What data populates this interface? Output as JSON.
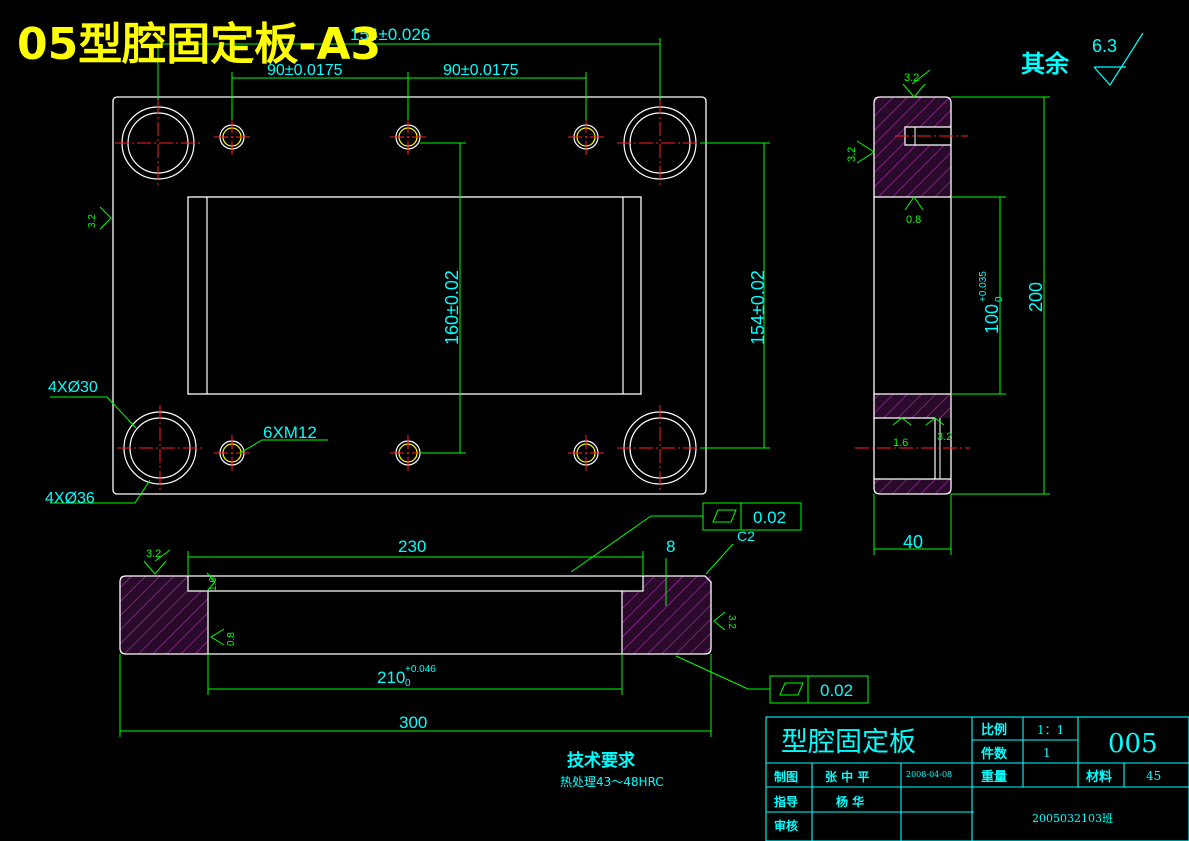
{
  "drawing": {
    "title": "05型腔固定板-A3",
    "roughness_note": {
      "label": "其余",
      "value": "6.3"
    }
  },
  "top_view": {
    "dim_154_tol": "154±0.026",
    "dim_90_left": "90±0.0175",
    "dim_90_right": "90±0.0175",
    "dim_160": "160±0.02",
    "dim_154_v": "154±0.02",
    "hole_label_30": "4XØ30",
    "hole_label_36": "4XØ36",
    "thread_label": "6XM12",
    "roughness_left": "3.2"
  },
  "side_view": {
    "rough_top": "3.2",
    "rough_left": "3.2",
    "rough_08": "0.8",
    "rough_16": "1.6",
    "rough_32b": "3.2",
    "dim_100": "100",
    "dim_100_tol_upper": "+0.035",
    "dim_100_tol_lower": "0",
    "dim_200": "200",
    "dim_40": "40"
  },
  "front_view": {
    "dim_230": "230",
    "dim_8": "8",
    "chamfer": "C2",
    "flatness_top": "0.02",
    "flatness_bottom": "0.02",
    "dim_210": "210",
    "dim_210_tol_upper": "+0.046",
    "dim_210_tol_lower": "0",
    "dim_300": "300",
    "rough_left": "3.2",
    "rough_16": "1.6",
    "rough_08": "0.8",
    "rough_right": "3.2"
  },
  "tech": {
    "heading": "技术要求",
    "line1": "热处理43～48HRC"
  },
  "title_block": {
    "part_name": "型腔固定板",
    "scale_label": "比例",
    "scale_value": "1：1",
    "qty_label": "件数",
    "qty_value": "1",
    "drawing_no": "005",
    "drawn_label": "制图",
    "drawn_name": "张 中 平",
    "drawn_date": "2008-04-08",
    "weight_label": "重量",
    "material_label": "材料",
    "material_value": "45",
    "guide_label": "指导",
    "guide_name": "杨 华",
    "review_label": "审核",
    "class_code": "2005032103班"
  },
  "colors": {
    "outline": "#ffffff",
    "dimension": "#00ff00",
    "text": "#00ffff",
    "centerline": "#ff0000",
    "hatch": "#ff00ff",
    "title": "#ffff00"
  }
}
